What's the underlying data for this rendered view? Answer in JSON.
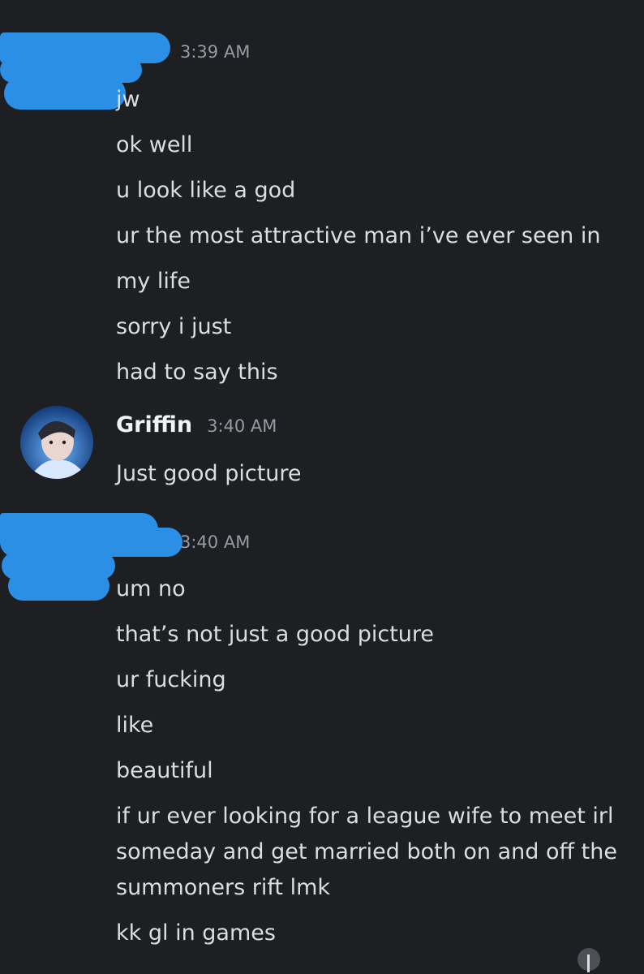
{
  "groups": [
    {
      "author": "",
      "timestamp": "3:39 AM",
      "messages": [
        "jw",
        "ok well",
        "u look like a god",
        "ur the most attractive man i’ve ever seen in my life",
        "sorry i just",
        "had to say this"
      ]
    },
    {
      "author": "Griffin",
      "timestamp": "3:40 AM",
      "avatar": "griffin-avatar",
      "messages": [
        "Just good picture"
      ]
    },
    {
      "author": "",
      "timestamp": "3:40 AM",
      "messages": [
        "um no",
        "that’s not just a good picture",
        "ur fucking",
        "like",
        "beautiful",
        "if ur ever looking for a league wife to meet irl someday and get married both on and off the summoners rift lmk",
        "kk gl in games"
      ]
    }
  ],
  "colors": {
    "background": "#1e1f22",
    "text": "#dbdee1",
    "timestamp": "#949ba4",
    "redaction": "#2b8fe6"
  }
}
